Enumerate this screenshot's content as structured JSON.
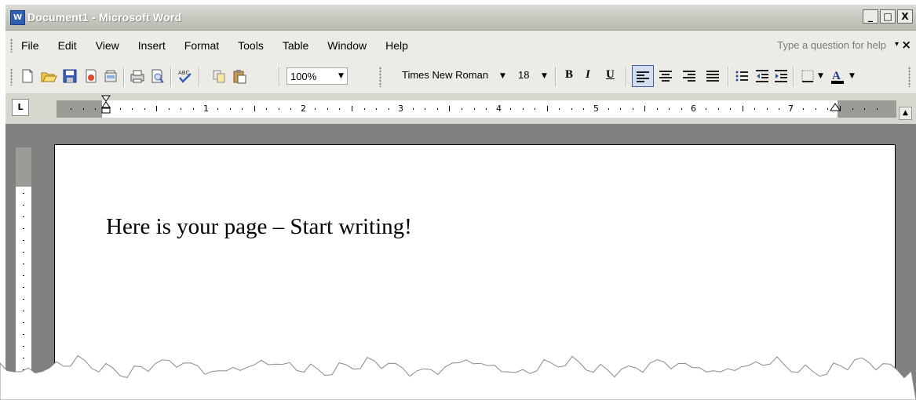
{
  "window": {
    "title": "Document1 - Microsoft Word",
    "app_icon": "W",
    "controls": {
      "minimize": "_",
      "maximize": "□",
      "close": "X"
    }
  },
  "menubar": {
    "items": [
      "File",
      "Edit",
      "View",
      "Insert",
      "Format",
      "Tools",
      "Table",
      "Window",
      "Help"
    ],
    "ask_placeholder": "Type a question for help",
    "ask_arrow": "▾",
    "close_doc": "×"
  },
  "toolbar": {
    "zoom": "100%",
    "font_name": "Times New Roman",
    "font_size": "18",
    "bold": "B",
    "italic": "I",
    "underline": "U",
    "icons": [
      "new-icon",
      "open-icon",
      "save-icon",
      "permission-icon",
      "print-icon",
      "print-preview-icon",
      "spelling-icon",
      "copy-icon",
      "paste-icon"
    ],
    "font_color": "#000000",
    "highlight_bar": "#c00000"
  },
  "ruler": {
    "tab_selector": "L",
    "numbers": [
      "1",
      "2",
      "3",
      "4",
      "5",
      "6",
      "7"
    ]
  },
  "document": {
    "body_text": "Here is your page – Start writing!"
  }
}
